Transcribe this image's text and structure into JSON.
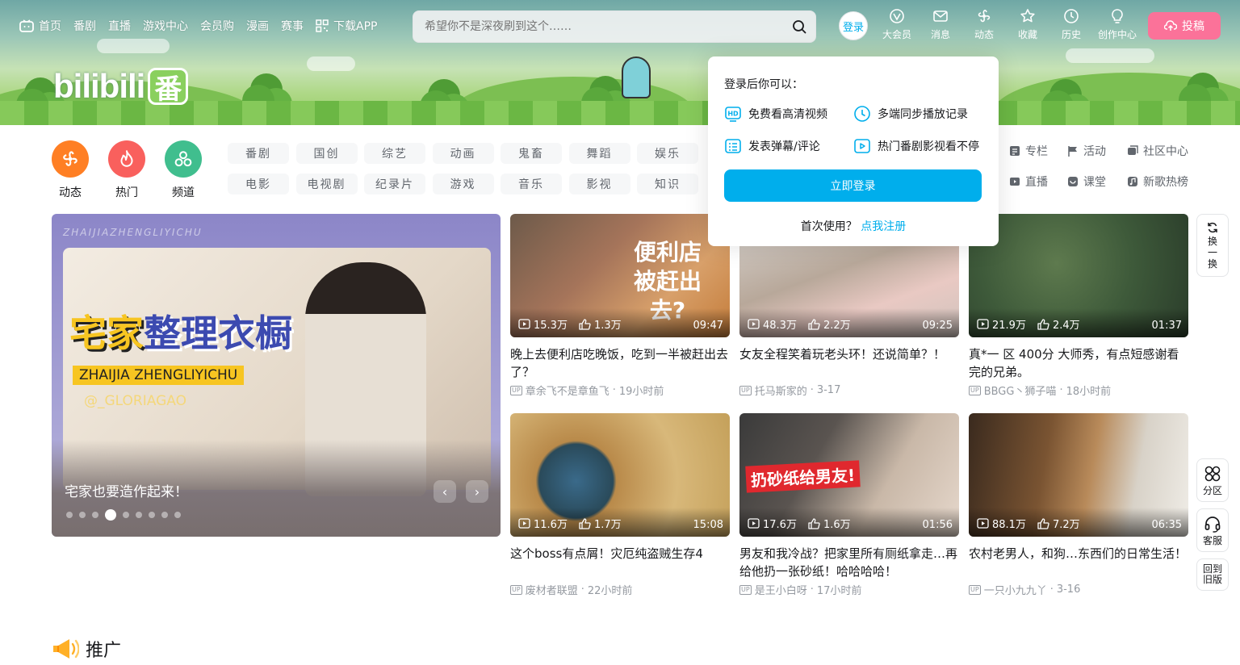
{
  "nav": {
    "items": [
      "首页",
      "番剧",
      "直播",
      "游戏中心",
      "会员购",
      "漫画",
      "赛事",
      "下载APP"
    ]
  },
  "search": {
    "placeholder": "希望你不是深夜刷到这个……"
  },
  "user": {
    "login_label": "登录"
  },
  "nav_right": [
    {
      "label": "大会员",
      "icon": "vip-icon"
    },
    {
      "label": "消息",
      "icon": "message-icon"
    },
    {
      "label": "动态",
      "icon": "dynamic-icon"
    },
    {
      "label": "收藏",
      "icon": "star-icon"
    },
    {
      "label": "历史",
      "icon": "clock-icon"
    },
    {
      "label": "创作中心",
      "icon": "bulb-icon"
    }
  ],
  "upload_label": "投稿",
  "logo": {
    "text": "bilibili",
    "fan": "番"
  },
  "big_channels": [
    {
      "label": "动态",
      "color": "#ff7f24"
    },
    {
      "label": "热门",
      "color": "#f9605d"
    },
    {
      "label": "频道",
      "color": "#40be8e"
    }
  ],
  "channels": [
    "番剧",
    "国创",
    "综艺",
    "动画",
    "鬼畜",
    "舞蹈",
    "娱乐",
    "电影",
    "电视剧",
    "纪录片",
    "游戏",
    "音乐",
    "影视",
    "知识"
  ],
  "side_channels": [
    {
      "label": "专栏"
    },
    {
      "label": "活动"
    },
    {
      "label": "社区中心"
    },
    {
      "label": "直播"
    },
    {
      "label": "课堂"
    },
    {
      "label": "新歌热榜"
    }
  ],
  "carousel": {
    "watermark": "ZHAIJIAZHENGLIYICHU",
    "title_a": "宅家",
    "title_b": "整理衣橱",
    "sub1": "ZHAIJIA ZHENGLIYICHU",
    "sub2": "@_GLORIAGAO",
    "caption": "宅家也要造作起来！",
    "active_dot": 4
  },
  "videos": [
    {
      "views": "15.3万",
      "likes": "1.3万",
      "duration": "09:47",
      "title": "晚上去便利店吃晚饭，吃到一半被赶出去了？",
      "author": "章余飞不是章鱼飞",
      "date": "19小时前",
      "overlay": "便利店 被赶出去?"
    },
    {
      "views": "48.3万",
      "likes": "2.2万",
      "duration": "09:25",
      "title": "女友全程笑着玩老头环！还说简单？！",
      "author": "托马斯家的",
      "date": "3-17",
      "overlay": ""
    },
    {
      "views": "21.9万",
      "likes": "2.4万",
      "duration": "01:37",
      "title": "真*一 区 400分 大师秀，有点短感谢看完的兄弟。",
      "author": "BBGG丶狮子喵",
      "date": "18小时前",
      "overlay": ""
    },
    {
      "views": "11.6万",
      "likes": "1.7万",
      "duration": "15:08",
      "title": "这个boss有点屑！灾厄纯盗贼生存4",
      "author": "废材者联盟",
      "date": "22小时前",
      "overlay": ""
    },
    {
      "views": "17.6万",
      "likes": "1.6万",
      "duration": "01:56",
      "title": "男友和我冷战？把家里所有厕纸拿走…再给他扔一张砂纸！哈哈哈哈！",
      "author": "是王小白呀",
      "date": "17小时前",
      "overlay": "扔砂纸给男友!"
    },
    {
      "views": "88.1万",
      "likes": "7.2万",
      "duration": "06:35",
      "title": "农村老男人，和狗…东西们的日常生活！",
      "author": "一只小九九丫",
      "date": "3-16",
      "overlay": ""
    }
  ],
  "popup": {
    "title": "登录后你可以：",
    "features": [
      "免费看高清视频",
      "多端同步播放记录",
      "发表弹幕/评论",
      "热门番剧影视看不停"
    ],
    "login_button": "立即登录",
    "register_prompt": "首次使用？",
    "register_link": "点我注册"
  },
  "float": {
    "refresh": "换一换",
    "zone": "分区",
    "service": "客服",
    "old": "回到旧版"
  },
  "promo": {
    "title": "推广"
  },
  "colors": {
    "accent": "#00aeec",
    "pink": "#fb7299"
  }
}
